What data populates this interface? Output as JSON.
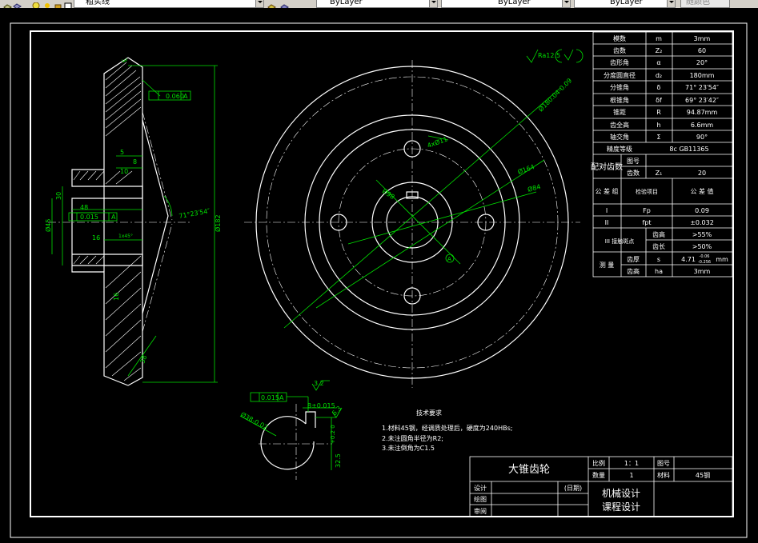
{
  "toolbar": {
    "layer_label": "粗实线",
    "color_value": "ByLayer",
    "linetype_value": "ByLayer",
    "lineweight_value": "ByLayer",
    "plotstyle_value": "随颜色"
  },
  "params_table": [
    {
      "name": "模数",
      "sym": "m",
      "val": "3mm"
    },
    {
      "name": "齿数",
      "sym": "Z₂",
      "val": "60"
    },
    {
      "name": "齿形角",
      "sym": "α",
      "val": "20°"
    },
    {
      "name": "分度圆直径",
      "sym": "d₂",
      "val": "180mm"
    },
    {
      "name": "分锥角",
      "sym": "δ",
      "val": "71° 23′54″"
    },
    {
      "name": "根锥角",
      "sym": "δf",
      "val": "69° 23′42″"
    },
    {
      "name": "锥距",
      "sym": "R",
      "val": "94.87mm"
    },
    {
      "name": "齿全高",
      "sym": "h",
      "val": "6.6mm"
    },
    {
      "name": "轴交角",
      "sym": "Σ",
      "val": "90°"
    }
  ],
  "precision": {
    "label": "精度等级",
    "value": "8c GB11365"
  },
  "mating": {
    "label": "配对齿数",
    "row1_label": "图号",
    "row1_value": "",
    "row2_label": "齿数",
    "row2_sym": "Z₁",
    "row2_value": "20"
  },
  "tolerance_head": {
    "col1": "公 差 组",
    "col2": "检验项目",
    "col3": "公 差 值"
  },
  "tolerance_rows": [
    {
      "group": "I",
      "item": "Fp",
      "value": "0.09"
    },
    {
      "group": "II",
      "item": "fpt",
      "value": "±0.032"
    }
  ],
  "contact": {
    "group": "III 接触斑点",
    "rows": [
      {
        "item": "齿高",
        "value": ">55%"
      },
      {
        "item": "齿长",
        "value": ">50%"
      }
    ]
  },
  "measure": {
    "label": "测 量",
    "rows": [
      {
        "item": "齿厚",
        "sym": "s",
        "value": "4.71",
        "upper": "-0.06",
        "lower": "-0.256",
        "unit": "mm"
      },
      {
        "item": "齿高",
        "sym": "ha",
        "value": "3mm"
      }
    ]
  },
  "tech_req": {
    "title": "技术要求",
    "lines": [
      "1.材料45钢，经调质处理后，硬度为240HBs;",
      "2.未注圆角半径为R2;",
      "3.未注倒角为C1.5"
    ]
  },
  "title_block": {
    "part_name": "大锥齿轮",
    "scale_label": "比例",
    "scale_value": "1：1",
    "drawing_no_label": "图号",
    "drawing_no_value": "",
    "qty_label": "数量",
    "qty_value": "1",
    "material_label": "材料",
    "material_value": "45钢",
    "design_label": "设计",
    "date_label": "(日期)",
    "draw_label": "绘图",
    "review_label": "审阅",
    "course_line1": "机械设计",
    "course_line2": "课程设计"
  },
  "dims": {
    "roughness": "Ra12.5",
    "phi180": "Ø180.04-0.09",
    "phi164": "Ø164",
    "phi84": "Ø84",
    "phi98": "Ø98",
    "holes": "4xØ11",
    "runout": "0.060",
    "datum_a": "A",
    "len48": "48",
    "coax": "0.015",
    "len16": "16",
    "chamfer": "1x45°",
    "dia45": "Ø45",
    "len30": "30",
    "phi182": "Ø182",
    "angle": "71°23′54″",
    "len38": "38",
    "len5": "5",
    "len10": "10",
    "len8": "8",
    "len16b": "16",
    "keyway_tol": "0.015",
    "keyway_width": "8±0.015",
    "ra32a": "3.2",
    "ra63": "6.3",
    "bore_dim": "Ø38-0.02",
    "bore_depth": "32.5",
    "bore_depth_tol": "+0.2 0",
    "ra32b": "3.2",
    "leader_A": "A"
  }
}
